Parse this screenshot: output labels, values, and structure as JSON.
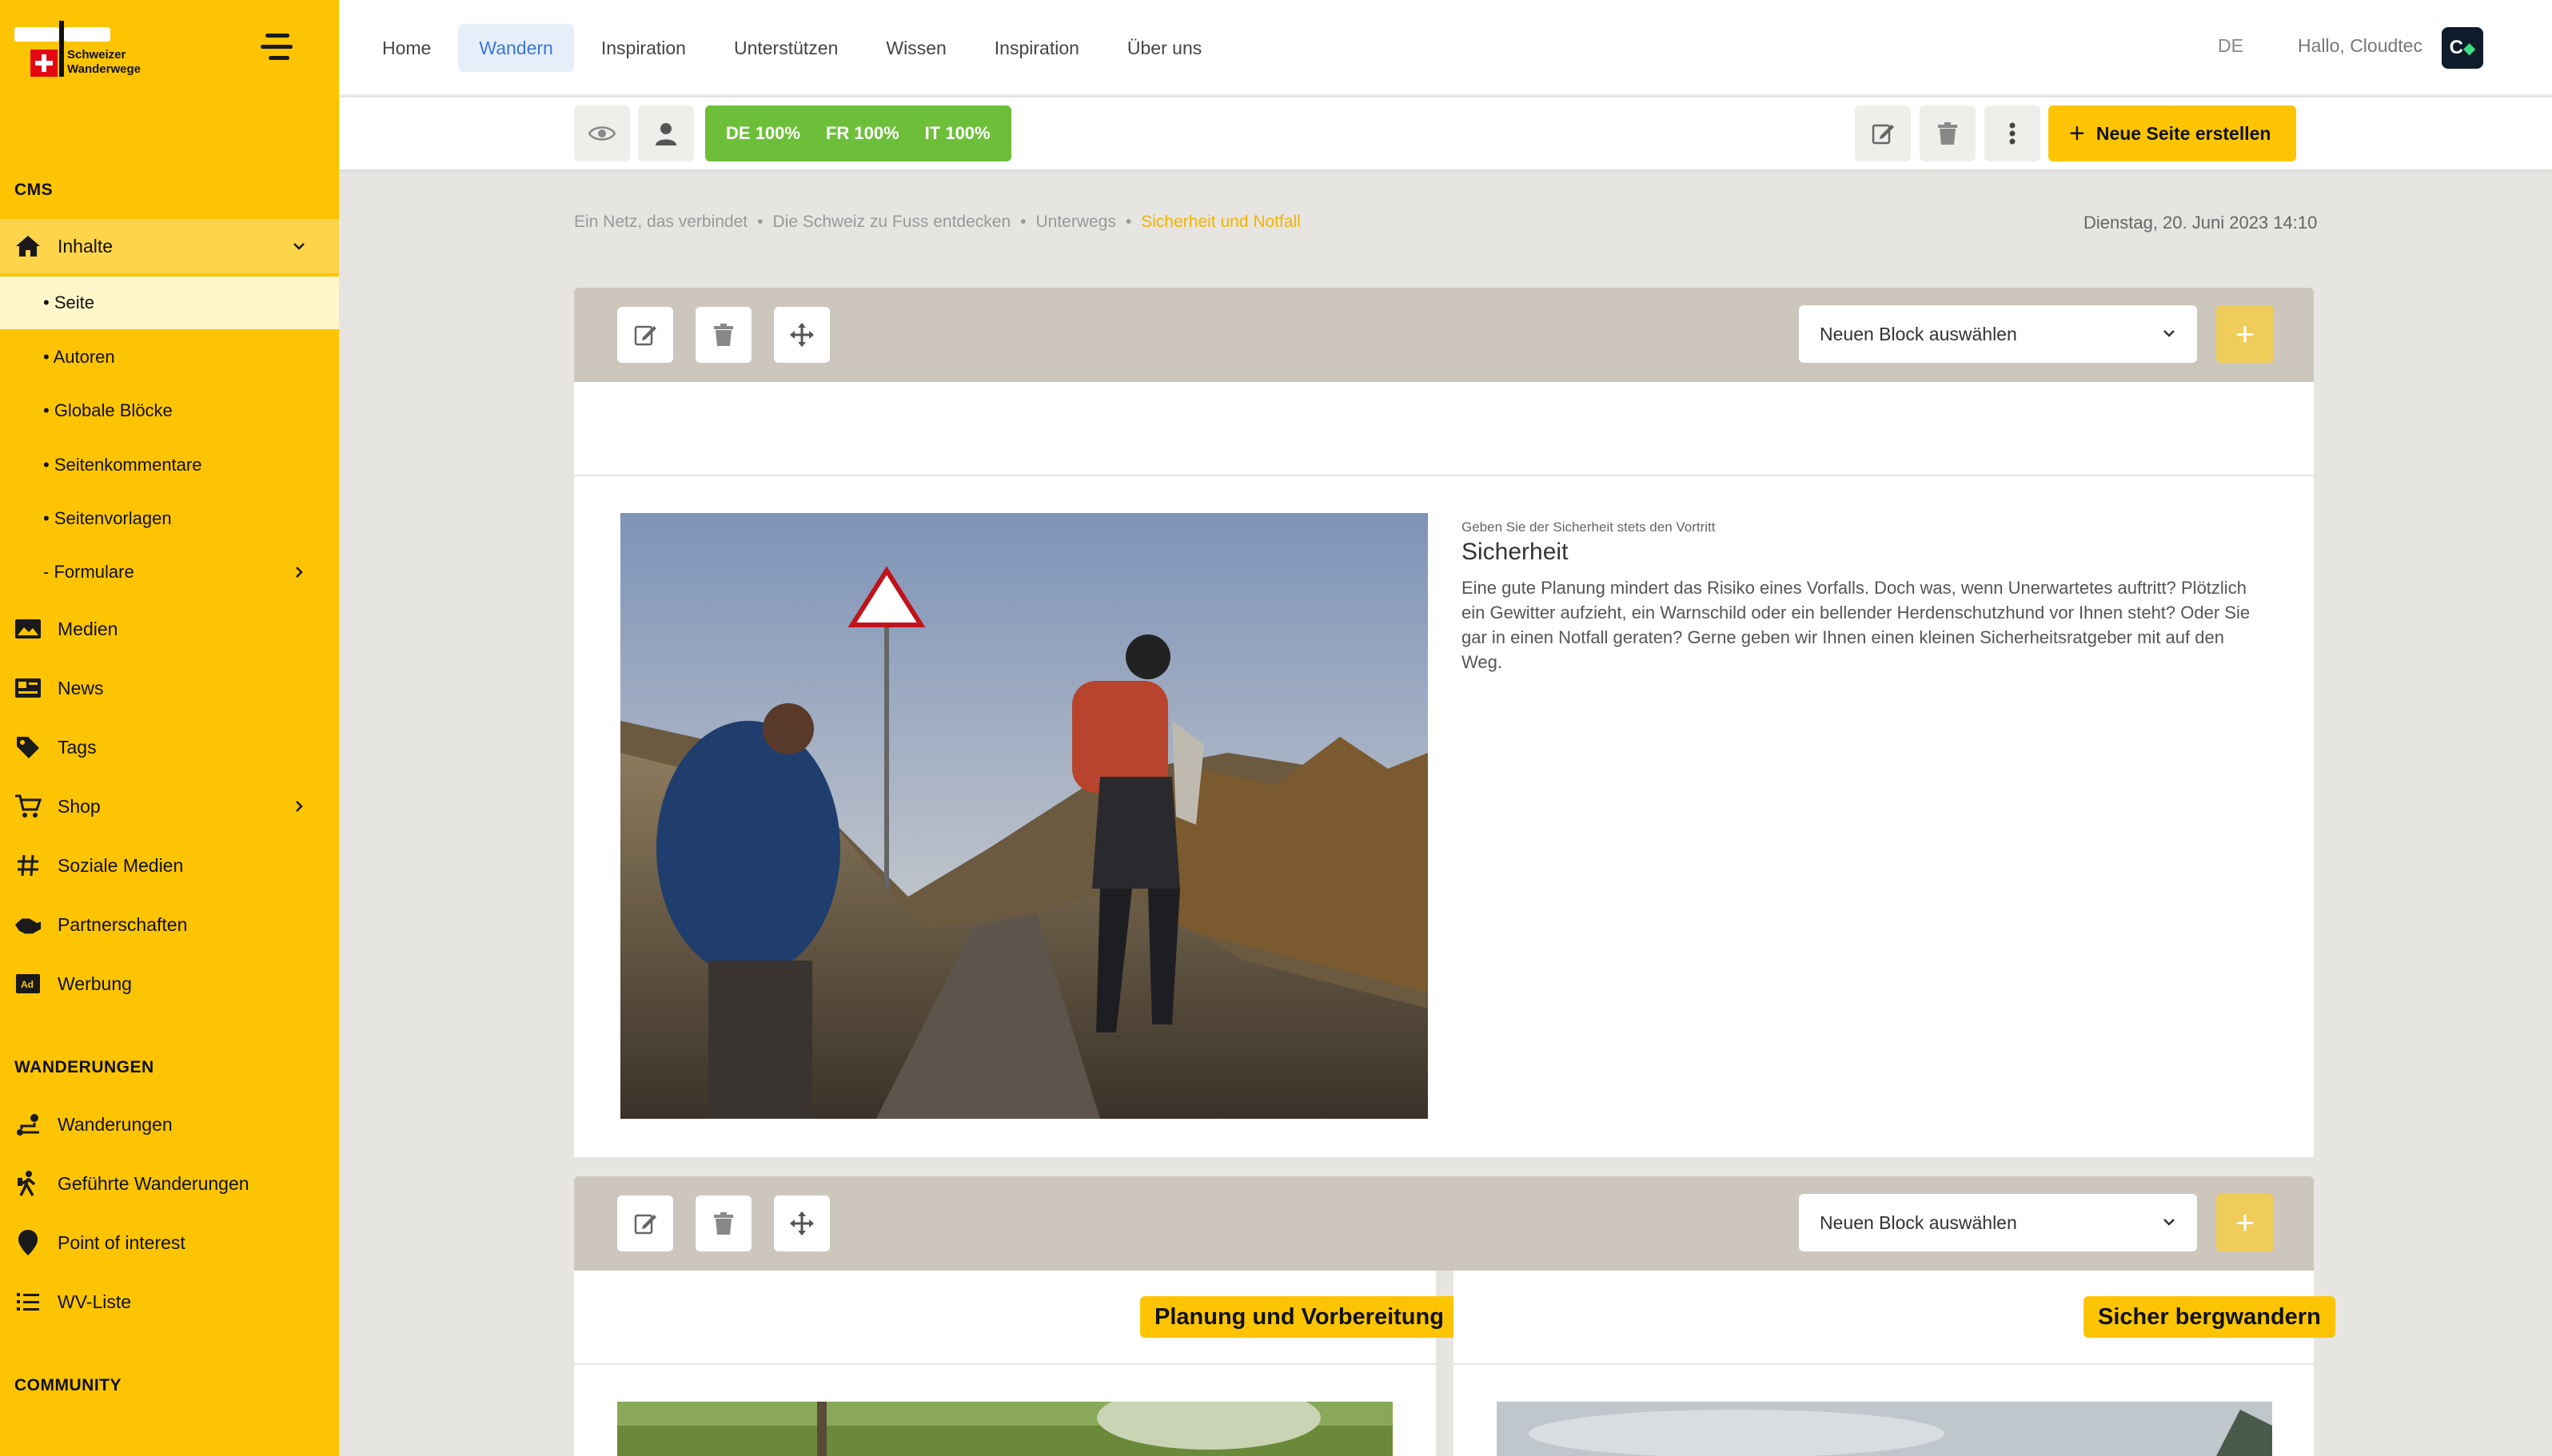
{
  "brand": {
    "logo_text_line1": "Schweizer",
    "logo_text_line2": "Wanderwege"
  },
  "sidebar": {
    "cms_title": "CMS",
    "items": [
      {
        "label": "Inhalte",
        "icon": "home-icon"
      },
      {
        "label": "Medien",
        "icon": "image-icon"
      },
      {
        "label": "News",
        "icon": "newspaper-icon"
      },
      {
        "label": "Tags",
        "icon": "tag-icon"
      },
      {
        "label": "Shop",
        "icon": "cart-icon"
      },
      {
        "label": "Soziale Medien",
        "icon": "hashtag-icon"
      },
      {
        "label": "Partnerschaften",
        "icon": "handshake-icon"
      },
      {
        "label": "Werbung",
        "icon": "ad-icon"
      }
    ],
    "subitems": [
      {
        "label": "• Seite"
      },
      {
        "label": "• Autoren"
      },
      {
        "label": "• Globale Blöcke"
      },
      {
        "label": "• Seitenkommentare"
      },
      {
        "label": "• Seitenvorlagen"
      },
      {
        "label": "- Formulare"
      }
    ],
    "wanderungen_title": "WANDERUNGEN",
    "wanderungen_items": [
      {
        "label": "Wanderungen",
        "icon": "route-icon"
      },
      {
        "label": "Geführte Wanderungen",
        "icon": "hiker-icon"
      },
      {
        "label": "Point of interest",
        "icon": "map-pin-icon"
      },
      {
        "label": "WV-Liste",
        "icon": "list-icon"
      }
    ],
    "community_title": "COMMUNITY"
  },
  "topnav": {
    "items": [
      "Home",
      "Wandern",
      "Inspiration",
      "Unterstützen",
      "Wissen",
      "Inspiration",
      "Über uns"
    ],
    "language": "DE",
    "greeting": "Hallo, Cloudtec",
    "avatar_text": "C"
  },
  "toolbar": {
    "lang_status": [
      "DE 100%",
      "FR 100%",
      "IT 100%"
    ],
    "new_page_label": "Neue Seite erstellen"
  },
  "breadcrumb": {
    "items": [
      "Ein Netz, das verbindet",
      "Die Schweiz zu Fuss entdecken",
      "Unterwegs",
      "Sicherheit und Notfall"
    ],
    "separator": "•"
  },
  "date": "Dienstag, 20. Juni 2023 14:10",
  "block_select_placeholder": "Neuen Block auswählen",
  "block1": {
    "kicker": "Geben Sie der Sicherheit stets den Vortritt",
    "title": "Sicherheit",
    "text": "Eine gute Planung mindert das Risiko eines Vorfalls. Doch was, wenn Unerwartetes auftritt? Plötzlich ein Gewitter aufzieht, ein Warnschild oder ein bellender Herdenschutzhund vor Ihnen steht? Oder Sie gar in einen Notfall geraten? Gerne geben wir Ihnen einen kleinen Sicherheitsratgeber mit auf den Weg."
  },
  "block2": {
    "tag_left": "Planung und Vorbereitung",
    "tag_right": "Sicher bergwandern"
  },
  "colors": {
    "brand_yellow": "#fcc402",
    "lang_green": "#6dbf3a",
    "active_blue": "#3a78d8"
  }
}
